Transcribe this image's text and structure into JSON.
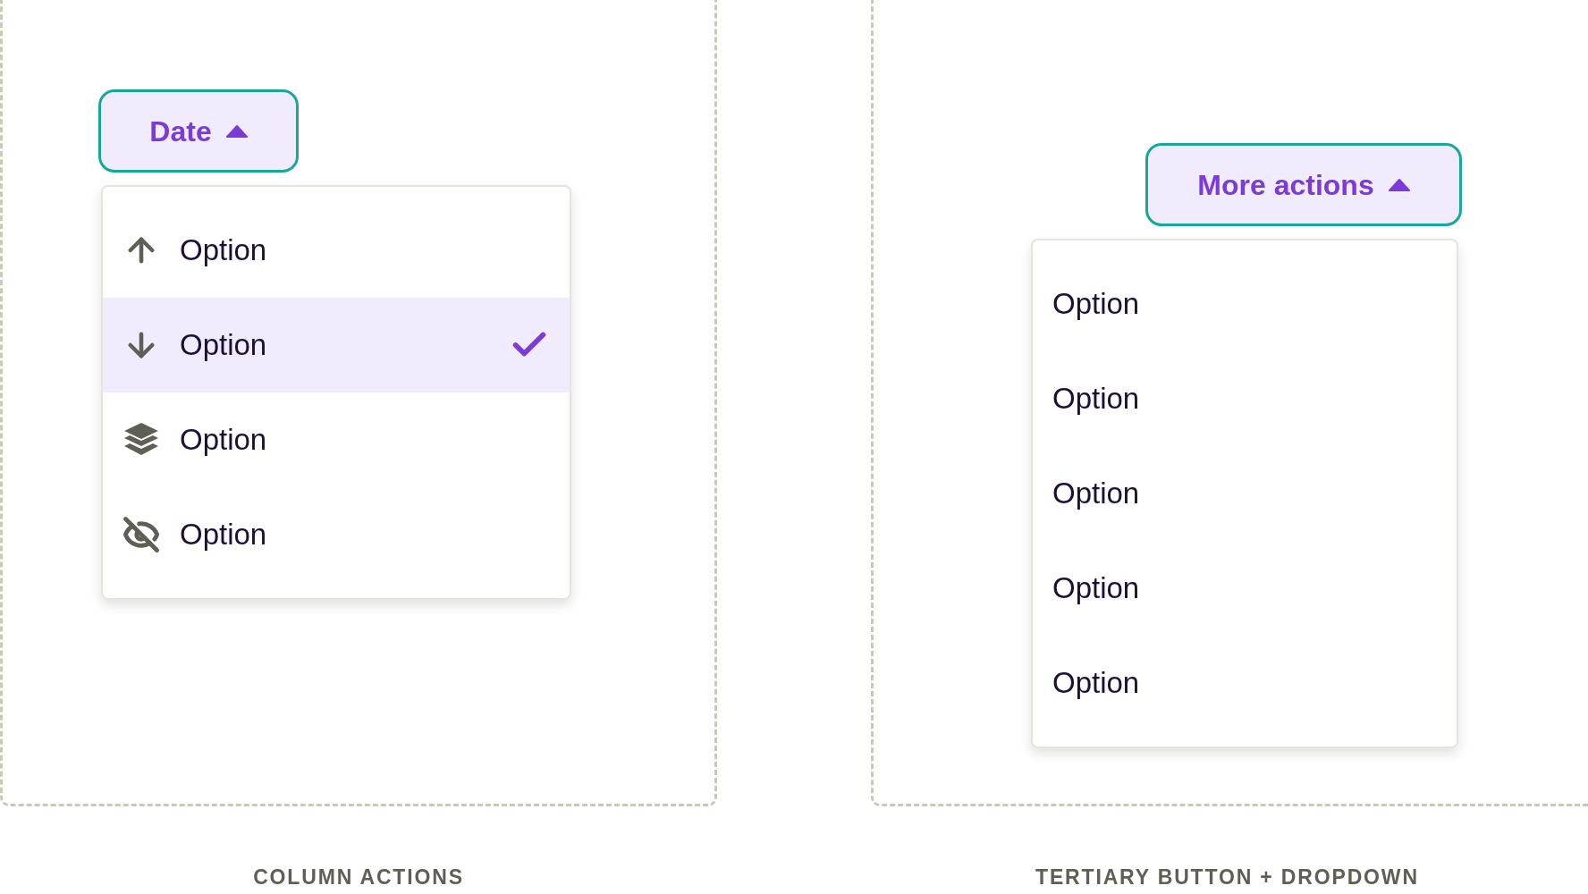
{
  "panels": [
    {
      "kind": "column-actions",
      "button": {
        "label": "Date",
        "expanded": true
      },
      "options": [
        {
          "label": "Option",
          "kind": "sort-ascending",
          "selected": false
        },
        {
          "label": "Option",
          "kind": "sort-descending",
          "selected": true
        },
        {
          "label": "Option",
          "kind": "group",
          "selected": false
        },
        {
          "label": "Option",
          "kind": "hide",
          "selected": false
        }
      ],
      "caption": "COLUMN ACTIONS"
    },
    {
      "kind": "tertiary",
      "button": {
        "label": "More actions",
        "expanded": true
      },
      "options": [
        {
          "label": "Option"
        },
        {
          "label": "Option"
        },
        {
          "label": "Option"
        },
        {
          "label": "Option"
        },
        {
          "label": "Option"
        }
      ],
      "caption": "TERTIARY BUTTON + DROPDOWN"
    }
  ]
}
